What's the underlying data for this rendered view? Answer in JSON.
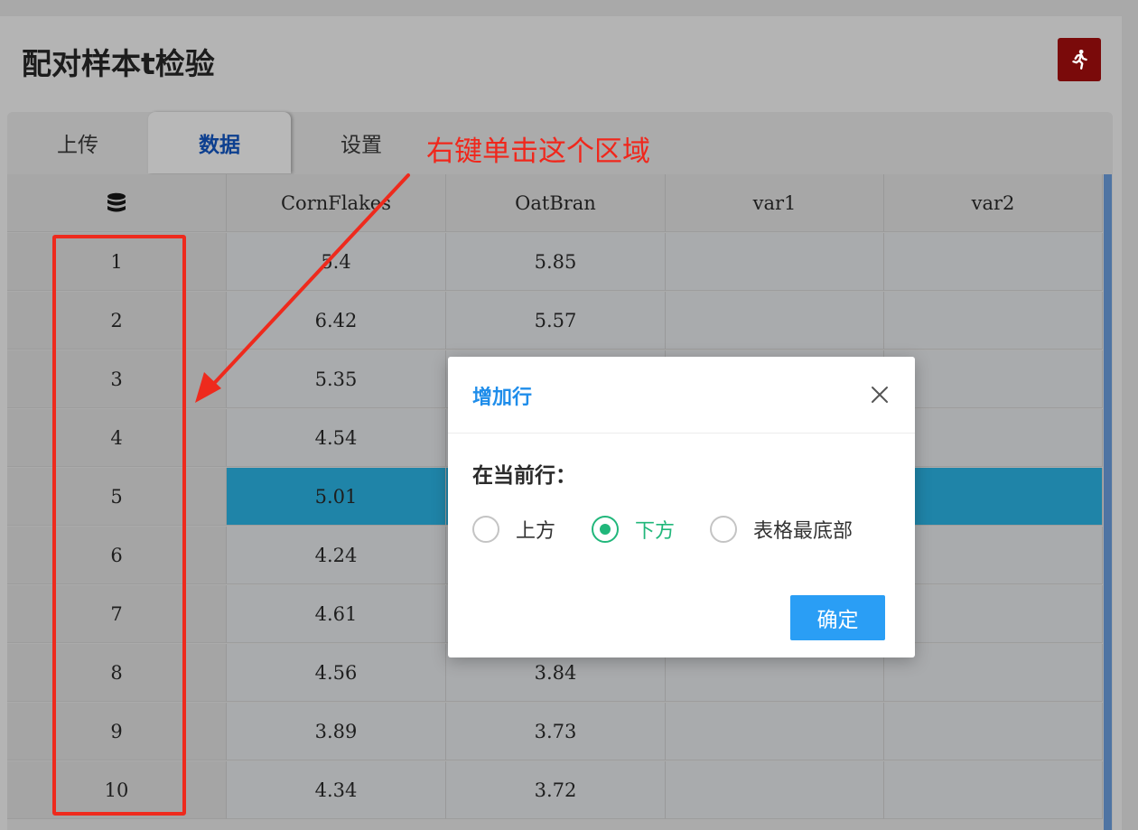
{
  "page": {
    "title": "配对样本t检验"
  },
  "tabs": [
    {
      "label": "上传"
    },
    {
      "label": "数据"
    },
    {
      "label": "设置"
    }
  ],
  "annotation": {
    "text": "右键单击这个区域"
  },
  "table": {
    "index_header_icon": "database-icon",
    "headers": [
      "CornFlakes",
      "OatBran",
      "var1",
      "var2"
    ],
    "rows": [
      {
        "index": "1",
        "cells": [
          "5.4",
          "5.85",
          "",
          ""
        ]
      },
      {
        "index": "2",
        "cells": [
          "6.42",
          "5.57",
          "",
          ""
        ]
      },
      {
        "index": "3",
        "cells": [
          "5.35",
          "",
          "",
          ""
        ]
      },
      {
        "index": "4",
        "cells": [
          "4.54",
          "",
          "",
          ""
        ]
      },
      {
        "index": "5",
        "cells": [
          "5.01",
          "",
          "",
          ""
        ]
      },
      {
        "index": "6",
        "cells": [
          "4.24",
          "",
          "",
          ""
        ]
      },
      {
        "index": "7",
        "cells": [
          "4.61",
          "",
          "",
          ""
        ]
      },
      {
        "index": "8",
        "cells": [
          "4.56",
          "3.84",
          "",
          ""
        ]
      },
      {
        "index": "9",
        "cells": [
          "3.89",
          "3.73",
          "",
          ""
        ]
      },
      {
        "index": "10",
        "cells": [
          "4.34",
          "3.72",
          "",
          ""
        ]
      }
    ],
    "selected_row": "5"
  },
  "modal": {
    "title": "增加行",
    "label": "在当前行：",
    "options": [
      {
        "label": "上方",
        "checked": false
      },
      {
        "label": "下方",
        "checked": true
      },
      {
        "label": "表格最底部",
        "checked": false
      }
    ],
    "confirm_label": "确定"
  },
  "colors": {
    "accent": "#1f8dea",
    "radio_checked": "#21b77b",
    "selected_row": "#1f84a8",
    "annotation": "#f0271c",
    "run_button": "#7a0a0a"
  }
}
